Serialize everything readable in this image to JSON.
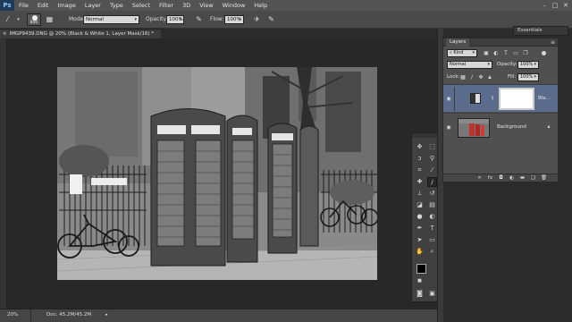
{
  "app": {
    "logo": "Ps"
  },
  "menu": [
    "File",
    "Edit",
    "Image",
    "Layer",
    "Type",
    "Select",
    "Filter",
    "3D",
    "View",
    "Window",
    "Help"
  ],
  "window_controls": {
    "minimize": "–",
    "maximize": "□",
    "close": "✕"
  },
  "options": {
    "brush_size": "800",
    "mode_label": "Mode:",
    "mode_value": "Normal",
    "opacity_label": "Opacity:",
    "opacity_value": "100%",
    "flow_label": "Flow:",
    "flow_value": "100%"
  },
  "workspace": {
    "value": "Essentials"
  },
  "document": {
    "tab_title": "IMGP9439.DNG @ 20% (Black & White 1, Layer Mask/16) *",
    "close_glyph": "⊗"
  },
  "status": {
    "zoom": "20%",
    "doc_info": "Doc: 45.2M/45.2M"
  },
  "layers_panel": {
    "tab_label": "Layers",
    "filter_value": "Kind",
    "blend_mode": "Normal",
    "opacity_label": "Opacity:",
    "opacity_value": "100%",
    "lock_label": "Lock:",
    "fill_label": "Fill:",
    "fill_value": "100%",
    "layers": [
      {
        "name": "Bla...",
        "selected": true,
        "type": "adjustment"
      },
      {
        "name": "Background",
        "selected": false,
        "type": "image"
      }
    ]
  },
  "colors": {
    "accent_selected_layer": "#5a6b8c",
    "foreground_swatch": "#000000",
    "background_swatch": "#ffffff"
  }
}
